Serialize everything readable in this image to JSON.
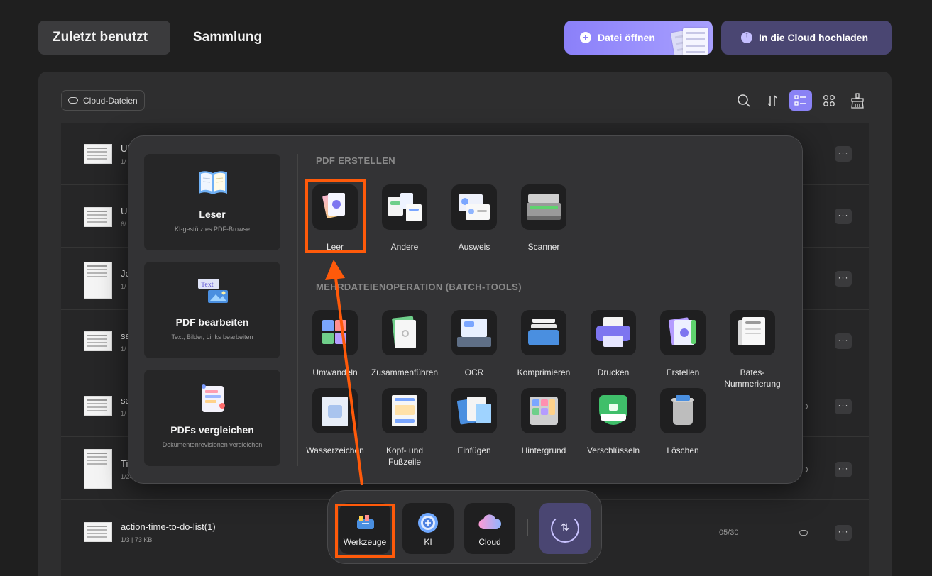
{
  "tabs": {
    "recent": "Zuletzt benutzt",
    "collection": "Sammlung"
  },
  "actions": {
    "open_file": "Datei öffnen",
    "upload_cloud": "In die Cloud hochladen"
  },
  "toolbar": {
    "cloud_files": "Cloud-Dateien",
    "icons": [
      "search-icon",
      "sort-icon",
      "list-view-icon",
      "grid-view-icon",
      "clean-icon"
    ]
  },
  "files": [
    {
      "title": "UP",
      "meta": "1/"
    },
    {
      "title": "U",
      "meta": "6/"
    },
    {
      "title": "Jo",
      "meta": "1/"
    },
    {
      "title": "sa",
      "meta": "1/"
    },
    {
      "title": "sa",
      "meta": "1/"
    },
    {
      "title": "Ti",
      "meta": "1/24"
    },
    {
      "title": "action-time-to-do-list(1)",
      "meta": "1/3 | 73 KB",
      "date": "05/30"
    }
  ],
  "popup": {
    "cards": [
      {
        "title": "Leser",
        "subtitle": "KI-gestütztes PDF-Browse"
      },
      {
        "title": "PDF bearbeiten",
        "subtitle": "Text, Bilder, Links bearbeiten"
      },
      {
        "title": "PDFs vergleichen",
        "subtitle": "Dokumentenrevisionen vergleichen"
      }
    ],
    "create_section": "PDF ERSTELLEN",
    "create_tools": [
      "Leer",
      "Andere",
      "Ausweis",
      "Scanner"
    ],
    "batch_section": "MEHRDATEIENOPERATION (BATCH-TOOLS)",
    "batch_tools_row1": [
      "Umwandeln",
      "Zusammenführen",
      "OCR",
      "Komprimieren",
      "Drucken",
      "Erstellen",
      "Bates-Nummerierung"
    ],
    "batch_tools_row2": [
      "Wasserzeichen",
      "Kopf- und Fußzeile",
      "Einfügen",
      "Hintergrund",
      "Verschlüsseln",
      "Löschen"
    ]
  },
  "dock": {
    "tools": "Werkzeuge",
    "ai": "KI",
    "cloud": "Cloud"
  },
  "colors": {
    "accent": "#8a82f5",
    "highlight": "#ff5a0a",
    "background": "#1f1f1f"
  }
}
